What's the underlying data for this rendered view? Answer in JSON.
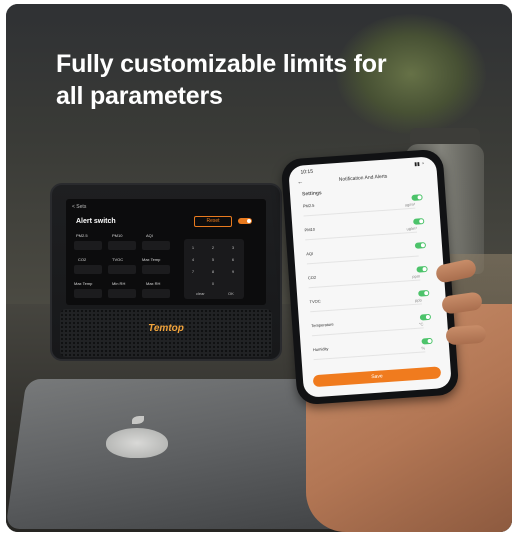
{
  "headline": {
    "line1": "Fully customizable limits for",
    "line2": "all parameters"
  },
  "device": {
    "brand": "Temtop",
    "screen": {
      "back": "< Sets",
      "title": "Alert switch",
      "reset_label": "Reset",
      "params": [
        "PM2.5",
        "PM10",
        "AQI",
        "CO2",
        "TVOC",
        "Max Temp",
        "Max Temp",
        "Min RH",
        "Max RH"
      ],
      "keypad": [
        "1",
        "2",
        "3",
        "4",
        "5",
        "6",
        "7",
        "8",
        "9",
        "0"
      ],
      "keypad_clear": "clear",
      "keypad_ok": "OK"
    }
  },
  "phone": {
    "time": "10:15",
    "header": "Notification And Alerts",
    "section": "Settings",
    "rows": [
      {
        "label": "PM2.5",
        "value": "ug/m³"
      },
      {
        "label": "PM10",
        "value": "ug/m³"
      },
      {
        "label": "AQI",
        "value": ""
      },
      {
        "label": "CO2",
        "value": "ppm"
      },
      {
        "label": "TVOC",
        "value": "ppb"
      },
      {
        "label": "Temperature",
        "value": "°C"
      },
      {
        "label": "Humidity",
        "value": "%"
      }
    ],
    "save_label": "Save"
  },
  "colors": {
    "accent_orange": "#f07b1e",
    "toggle_green": "#4cc36a",
    "brand_orange": "#f0a33c"
  }
}
